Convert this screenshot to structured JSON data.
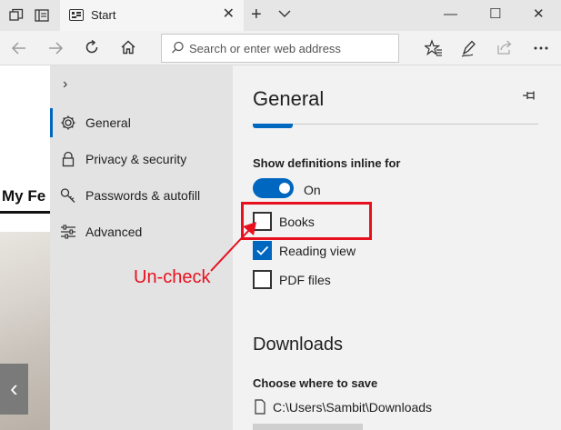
{
  "browser": {
    "tab": {
      "title": "Start",
      "close_glyph": "✕"
    },
    "new_tab_glyph": "+",
    "window": {
      "minimize": "—",
      "maximize": "☐",
      "close": "✕"
    },
    "address_bar": {
      "value": "",
      "placeholder": "Search or enter web address"
    }
  },
  "page": {
    "feed_title": "My Feed",
    "feed_visible_text": "My Fe",
    "prev_glyph": "‹"
  },
  "settings": {
    "sidebar": {
      "expand_glyph": "›",
      "items": [
        {
          "label": "General",
          "icon": "gear-icon",
          "active": true
        },
        {
          "label": "Privacy & security",
          "icon": "lock-icon",
          "active": false
        },
        {
          "label": "Passwords & autofill",
          "icon": "key-icon",
          "active": false
        },
        {
          "label": "Advanced",
          "icon": "sliders-icon",
          "active": false
        }
      ]
    },
    "panel": {
      "title": "General",
      "definitions": {
        "heading": "Show definitions inline for",
        "toggle_label": "On",
        "toggle_on": true,
        "options": [
          {
            "label": "Books",
            "checked": false
          },
          {
            "label": "Reading view",
            "checked": true
          },
          {
            "label": "PDF files",
            "checked": false
          }
        ]
      },
      "downloads": {
        "title": "Downloads",
        "save_heading": "Choose where to save",
        "path": "C:\\Users\\Sambit\\Downloads"
      }
    }
  },
  "annotation": {
    "text": "Un-check",
    "color": "#e8101e"
  },
  "colors": {
    "accent": "#0067c0",
    "annotation": "#e8101e"
  }
}
